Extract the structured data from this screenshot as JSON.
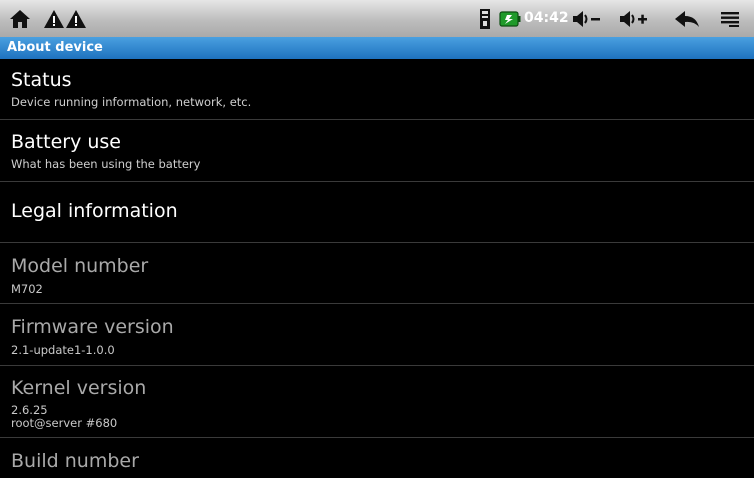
{
  "status_bar": {
    "clock": "04:42",
    "icons": [
      "home-icon",
      "warning-icon",
      "warning-icon",
      "sd-card-icon",
      "battery-charging-icon",
      "volume-down-icon",
      "volume-up-icon",
      "back-icon",
      "menu-icon"
    ],
    "colors": {
      "battery": "#1f9a2a",
      "clock": "#ffffff"
    }
  },
  "header": {
    "title": "About device",
    "color": "#2b82cf"
  },
  "items": [
    {
      "title": "Status",
      "summary": "Device running information, network, etc."
    },
    {
      "title": "Battery use",
      "summary": "What has been using the battery"
    },
    {
      "title": "Legal information"
    },
    {
      "title": "Model number",
      "summary": "M702"
    },
    {
      "title": "Firmware version",
      "summary": "2.1-update1-1.0.0"
    },
    {
      "title": "Kernel version",
      "summary_line1": "2.6.25",
      "summary_line2": "root@server #680"
    },
    {
      "title": "Build number"
    }
  ]
}
